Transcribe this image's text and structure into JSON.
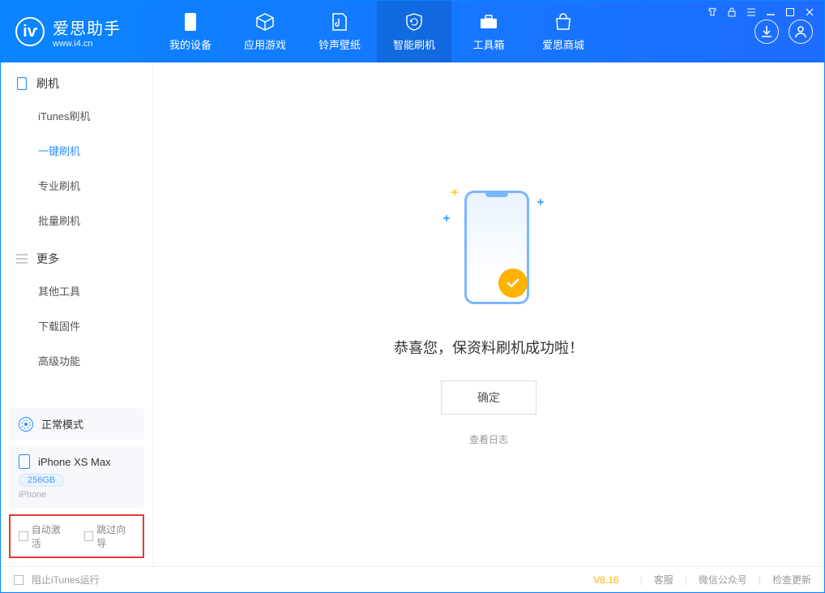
{
  "app": {
    "name": "爱思助手",
    "url": "www.i4.cn",
    "logo_letter": "iⱱ"
  },
  "tabs": {
    "device": "我的设备",
    "apps": "应用游戏",
    "ringtone": "铃声壁纸",
    "flash": "智能刷机",
    "toolbox": "工具箱",
    "store": "爱思商城"
  },
  "sidebar": {
    "flash_header": "刷机",
    "items": {
      "itunes_flash": "iTunes刷机",
      "oneclick_flash": "一键刷机",
      "pro_flash": "专业刷机",
      "batch_flash": "批量刷机"
    },
    "more_header": "更多",
    "more": {
      "other_tools": "其他工具",
      "download_firmware": "下载固件",
      "advanced": "高级功能"
    }
  },
  "mode": {
    "label": "正常模式"
  },
  "device": {
    "name": "iPhone XS Max",
    "storage": "256GB",
    "type": "iPhone"
  },
  "options": {
    "auto_activate": "自动激活",
    "skip_guide": "跳过向导"
  },
  "main": {
    "success_msg": "恭喜您，保资料刷机成功啦！",
    "ok": "确定",
    "view_log": "查看日志"
  },
  "status": {
    "block_itunes": "阻止iTunes运行",
    "version": "V8.16",
    "kefu": "客服",
    "wechat": "微信公众号",
    "update": "检查更新"
  }
}
